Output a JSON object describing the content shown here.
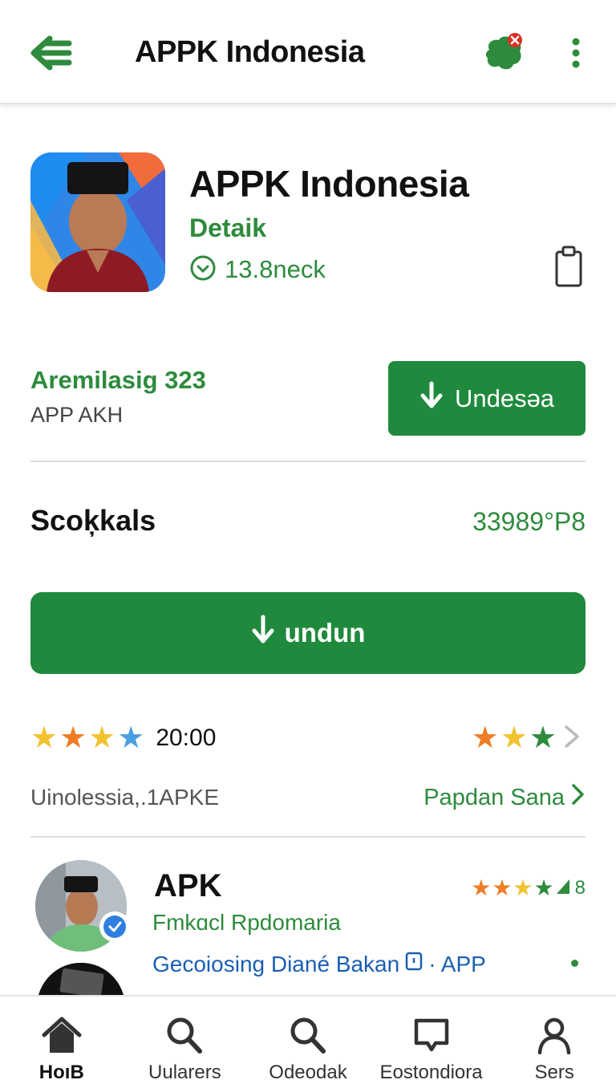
{
  "topbar": {
    "title": "APPK Indonesia"
  },
  "app": {
    "name": "APPK Indonesia",
    "detail": "Detaik",
    "size": "13.8neck"
  },
  "developer": {
    "name": "Aremilasig 323",
    "sub": "APP AKH",
    "install_label": "Undesəa"
  },
  "section": {
    "title": "Scoķkals",
    "value": "33989°P8"
  },
  "download": {
    "label": "undun"
  },
  "rating": {
    "left_stars": [
      "#f2c230",
      "#ee7d26",
      "#f2c230",
      "#4a9fe0"
    ],
    "time": "20:00",
    "right_stars": [
      "#ee7d26",
      "#f2c230",
      "#2e8b3d"
    ]
  },
  "meta": {
    "left": "Uinolessia,.1APKE",
    "link": "Papdan Sana"
  },
  "review": {
    "title": "APK",
    "sub": "Fmkɑcl Rpdomaria",
    "link": "Gecoiosing Diané Bakan",
    "link_suffix": "· APP",
    "stars": [
      "#ee7d26",
      "#ee7d26",
      "#f2c230",
      "#2e8b3d"
    ],
    "score": "8"
  },
  "nav": [
    {
      "label": "HoıB",
      "icon": "home-icon"
    },
    {
      "label": "Uularers",
      "icon": "search-icon"
    },
    {
      "label": "Odeodak",
      "icon": "search-icon"
    },
    {
      "label": "Eostondiora",
      "icon": "message-icon"
    },
    {
      "label": "Sers",
      "icon": "profile-icon"
    }
  ],
  "colors": {
    "accent": "#1f8a3d",
    "accent_text": "#2e8b3d",
    "link": "#1a5fb4"
  }
}
